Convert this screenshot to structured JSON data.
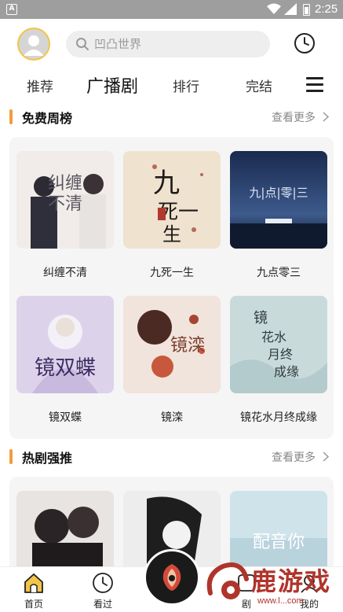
{
  "status_bar": {
    "time": "2:25",
    "notification_letter": "A",
    "icons": [
      "notification-icon",
      "wifi-icon",
      "signal-icon",
      "battery-icon"
    ]
  },
  "header": {
    "search_placeholder": "凹凸世界",
    "icons": [
      "avatar",
      "search-icon",
      "clock-icon"
    ]
  },
  "tabs": [
    {
      "label": "推荐",
      "active": false
    },
    {
      "label": "广播剧",
      "active": true
    },
    {
      "label": "排行",
      "active": false
    },
    {
      "label": "完结",
      "active": false
    }
  ],
  "sections": [
    {
      "title": "免费周榜",
      "more_label": "查看更多",
      "items": [
        {
          "title": "纠缠不清",
          "cover_text": "纠缠不清"
        },
        {
          "title": "九死一生",
          "cover_text": "九死一生"
        },
        {
          "title": "九点零三",
          "cover_text": "九|点|零|三"
        },
        {
          "title": "镜双蝶",
          "cover_text": "镜双蝶"
        },
        {
          "title": "镜滦",
          "cover_text": "镜滦"
        },
        {
          "title": "镜花水月终成缘",
          "cover_text": "镜花水月终成缘"
        }
      ]
    },
    {
      "title": "热剧强推",
      "more_label": "查看更多",
      "items": [
        {
          "title": "",
          "cover_text": ""
        },
        {
          "title": "",
          "cover_text": ""
        },
        {
          "title": "",
          "cover_text": "配音你"
        }
      ]
    }
  ],
  "bottom_nav": [
    {
      "label": "首页",
      "icon": "home-icon"
    },
    {
      "label": "看过",
      "icon": "clock-icon"
    },
    {
      "label": "",
      "icon": "center-logo-icon"
    },
    {
      "label": "剧",
      "icon": "drama-icon"
    },
    {
      "label": "我的",
      "icon": "profile-icon"
    }
  ],
  "watermark": {
    "text": "鹿游戏",
    "url": "www.l...com"
  },
  "colors": {
    "accent": "#f39c3b",
    "avatar_ring": "#f3c548",
    "watermark": "#b0342c"
  }
}
